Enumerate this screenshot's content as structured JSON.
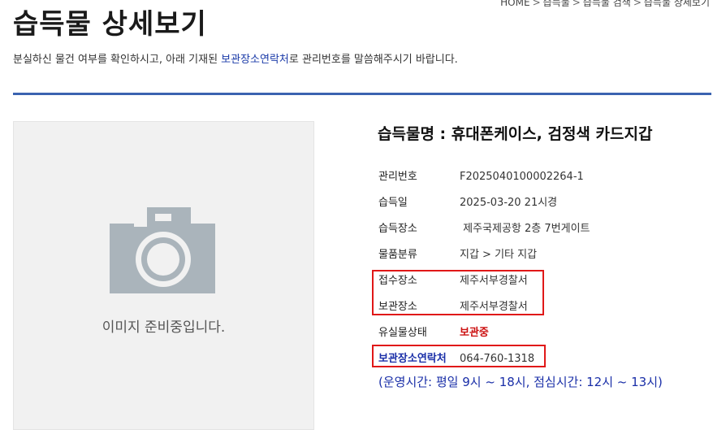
{
  "breadcrumb": [
    "HOME",
    "습득물",
    "습득물 검색",
    "습득물 상세보기"
  ],
  "page": {
    "title": "습득물 상세보기",
    "intro_before": "분실하신 물건 여부를 확인하시고, 아래 기재된 ",
    "intro_highlight": "보관장소연락처",
    "intro_after": "로 관리번호를 말씀해주시기 바랍니다."
  },
  "image": {
    "placeholder_text": "이미지 준비중입니다.",
    "icon": "camera-icon"
  },
  "item": {
    "name": "습득물명 : 휴대폰케이스, 검정색 카드지갑",
    "rows": [
      {
        "label": "관리번호",
        "value": "F2025040100002264-1"
      },
      {
        "label": "습득일",
        "value": "2025-03-20 21시경"
      },
      {
        "label": "습득장소",
        "value": " 제주국제공항 2층 7번게이트"
      },
      {
        "label": "물품분류",
        "value": "지갑 > 기타 지갑"
      },
      {
        "label": "접수장소",
        "value": "제주서부경찰서"
      },
      {
        "label": "보관장소",
        "value": "제주서부경찰서"
      },
      {
        "label": "유실물상태",
        "value": "보관중"
      },
      {
        "label": "보관장소연락처",
        "value": "064-760-1318"
      }
    ],
    "hours": "(운영시간: 평일 9시 ~ 18시, 점심시간: 12시 ~ 13시)"
  },
  "colors": {
    "accent_divider": "#3b63b0",
    "status_red": "#cc1111",
    "link_blue": "#1a2fa8",
    "highlight_box": "#e01818"
  }
}
